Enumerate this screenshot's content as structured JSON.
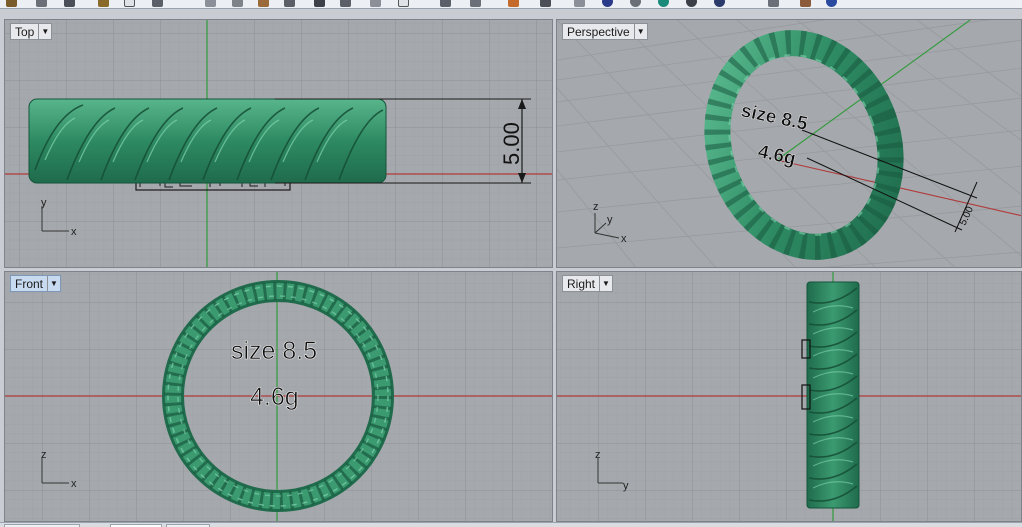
{
  "viewports": {
    "top": {
      "title": "Top",
      "dimension": "5.00",
      "axis_a": "y",
      "axis_b": "x"
    },
    "perspective": {
      "title": "Perspective",
      "dimension": "5.00",
      "engrave_size": "size 8.5",
      "engrave_weight": "4.6g",
      "axis_z": "z",
      "axis_a": "y",
      "axis_b": "x"
    },
    "front": {
      "title": "Front",
      "engrave_size": "size 8.5",
      "engrave_weight": "4.6g",
      "axis_a": "z",
      "axis_b": "x"
    },
    "right": {
      "title": "Right",
      "axis_a": "z",
      "axis_b": "y"
    }
  },
  "active_viewport": "Front",
  "icons": {
    "dropdown": "chevron-down-icon"
  },
  "colors": {
    "viewport_bg": "#a5a8ac",
    "grid_minor": "#9c9fa3",
    "grid_major": "#8d9094",
    "x_axis": "#b03a3a",
    "y_axis": "#2f9b3a",
    "ring_dark": "#1f6b4c",
    "ring_mid": "#2d8a62",
    "ring_light": "#58b58c",
    "active_title": "#c8daf0"
  }
}
